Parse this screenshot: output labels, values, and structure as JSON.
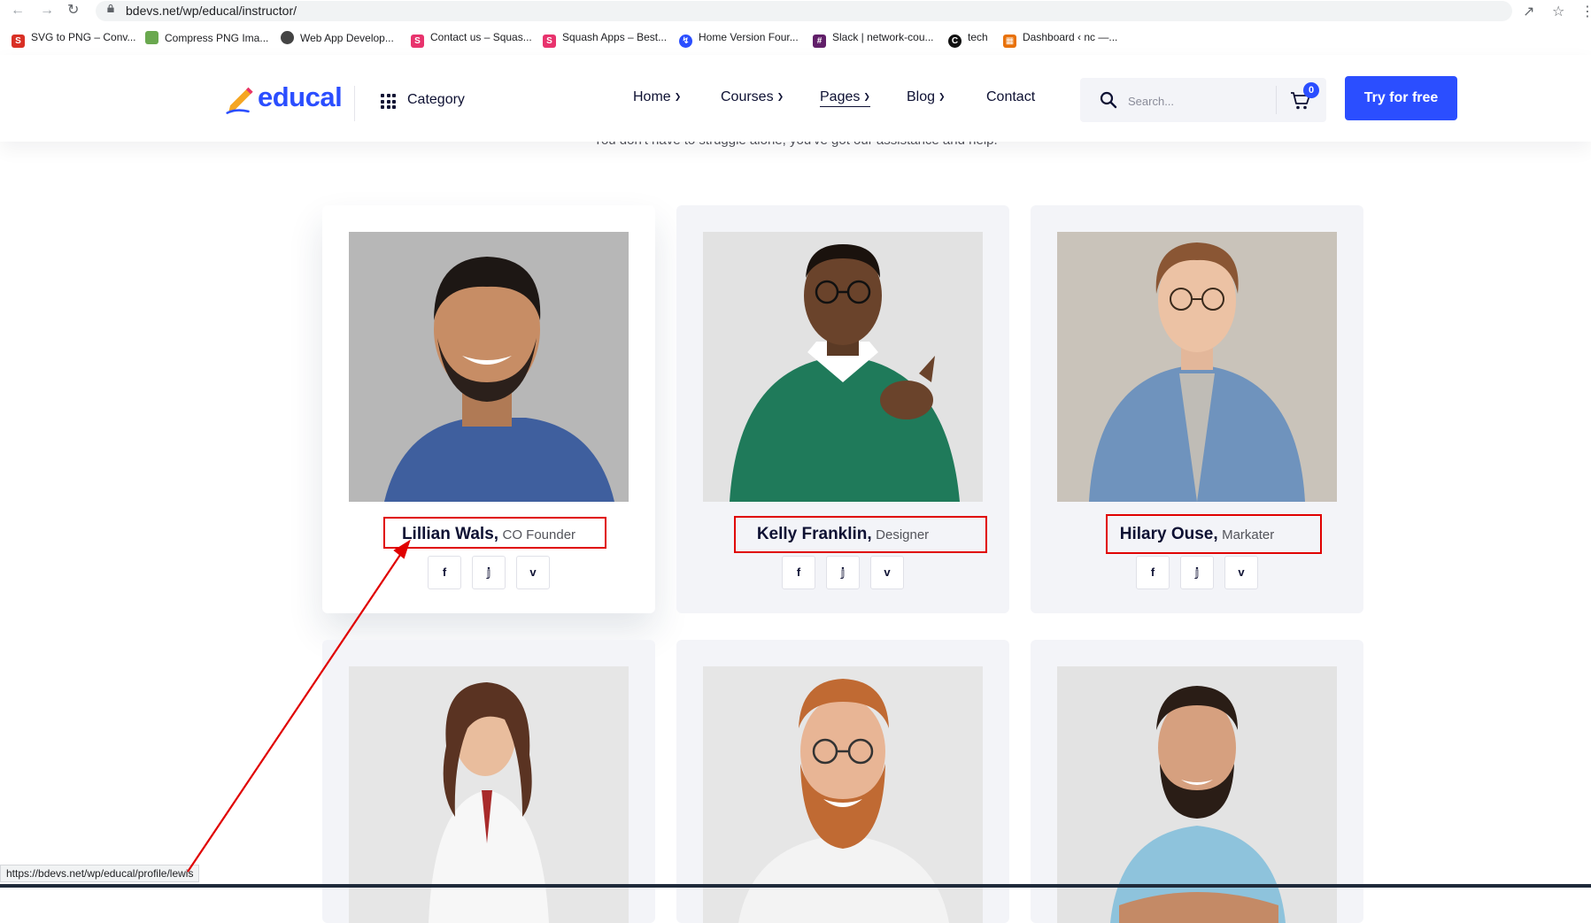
{
  "browser": {
    "url": "bdevs.net/wp/educal/instructor/",
    "bookmarks": [
      {
        "label": "SVG to PNG – Conv...",
        "icon": "svg-png-icon",
        "color": "#d93025"
      },
      {
        "label": "Compress PNG Ima...",
        "icon": "panda-icon",
        "color": "#6aa84f"
      },
      {
        "label": "Web App Develop...",
        "icon": "globe-icon",
        "color": "#444444"
      },
      {
        "label": "Contact us – Squas...",
        "icon": "squash-icon",
        "color": "#e8336d"
      },
      {
        "label": "Squash Apps – Best...",
        "icon": "squash-icon",
        "color": "#e8336d"
      },
      {
        "label": "Home Version Four...",
        "icon": "bolt-icon",
        "color": "#2b4eff"
      },
      {
        "label": "Slack | network-cou...",
        "icon": "slack-icon",
        "color": "#611f69"
      },
      {
        "label": "tech",
        "icon": "c-icon",
        "color": "#111111"
      },
      {
        "label": "Dashboard ‹ nc —...",
        "icon": "dashboard-icon",
        "color": "#e8710a"
      }
    ],
    "status_url": "https://bdevs.net/wp/educal/profile/lewis"
  },
  "header": {
    "logo_text": "educal",
    "category_label": "Category",
    "menu": [
      {
        "label": "Home"
      },
      {
        "label": "Courses"
      },
      {
        "label": "Pages"
      },
      {
        "label": "Blog"
      },
      {
        "label": "Contact"
      }
    ],
    "search_placeholder": "Search...",
    "cart_count": "0",
    "cta_label": "Try for free"
  },
  "section": {
    "subtitle": "You don't have to struggle alone, you've got our assistance and help."
  },
  "instructors": [
    {
      "name": "Lillian Wals,",
      "role": "CO Founder"
    },
    {
      "name": "Kelly Franklin,",
      "role": "Designer"
    },
    {
      "name": "Hilary Ouse,",
      "role": "Markater"
    },
    {
      "name": "",
      "role": ""
    },
    {
      "name": "",
      "role": ""
    },
    {
      "name": "",
      "role": ""
    }
  ],
  "social_icons": [
    "facebook-icon",
    "twitter-icon",
    "vimeo-icon"
  ],
  "colors": {
    "brand": "#2b4eff",
    "text": "#0e1133",
    "card_bg": "#f3f4f8",
    "highlight": "#e00000"
  }
}
